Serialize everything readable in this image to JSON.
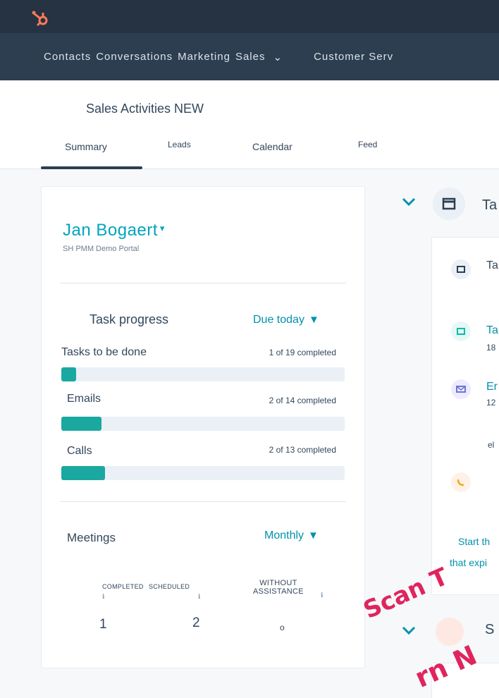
{
  "nav": {
    "items": [
      "Contacts",
      "Conversations",
      "Marketing",
      "Sales"
    ],
    "sales_caret": "⌄",
    "customer_service": "Customer Serv"
  },
  "header": {
    "title": "Sales Activities NEW",
    "tabs": [
      "Summary",
      "Leads",
      "Calendar",
      "Feed"
    ]
  },
  "user": {
    "name": "Jan Bogaert",
    "caret": "▾",
    "portal": "SH PMM Demo Portal"
  },
  "task_progress": {
    "label": "Task progress",
    "filter": "Due today",
    "filter_icon": "▼",
    "rows": [
      {
        "label": "Tasks to be done",
        "count": "1 of 19 completed",
        "fraction": 0.053
      },
      {
        "label": "Emails",
        "count": "2 of 14 completed",
        "fraction": 0.143
      },
      {
        "label": "Calls",
        "count": "2 of 13 completed",
        "fraction": 0.154
      }
    ],
    "bar_color": "#1aa8a0"
  },
  "meetings": {
    "label": "Meetings",
    "filter": "Monthly",
    "filter_icon": "▼",
    "completed_header": "COMPLETED",
    "scheduled_header": "SCHEDULED",
    "without_header_1": "WITHOUT",
    "without_header_2": "ASSISTANCE",
    "info_icon": "ℹ",
    "completed_value": "1",
    "scheduled_value": "2",
    "without_value": "o"
  },
  "right_panel": {
    "title": "Ta",
    "item1": "Ta",
    "item2_title": "Ta",
    "item2_sub": "18",
    "item3_title": "Er",
    "item3_sub": "12",
    "item4": "el",
    "footer_line1": "Start th",
    "footer_line2": "that expi",
    "second_title": "S"
  },
  "overlay_text": {
    "line1": "Scan T",
    "line2": "rn N"
  },
  "colors": {
    "accent": "#00a4bd",
    "nav_bg": "#2d3e50",
    "overlay": "#e0245e"
  }
}
